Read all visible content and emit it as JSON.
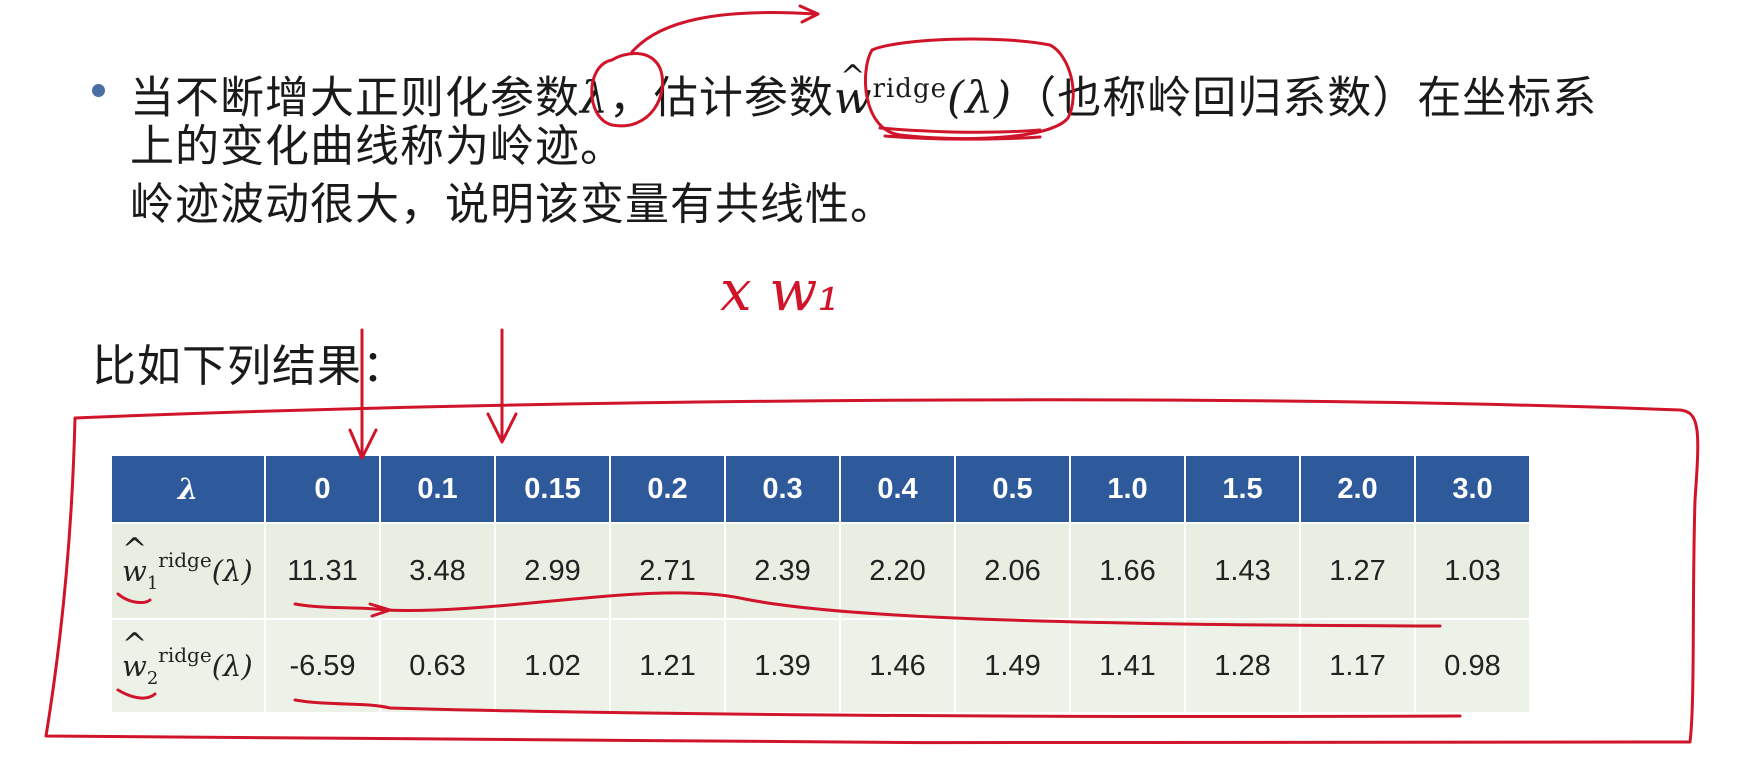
{
  "slide": {
    "line1_a": "当不断增大正则化参数",
    "lambda": "λ",
    "line1_b": "，估计参数",
    "w": "w",
    "ridge_sup": "ridge",
    "lambda_arg": "(λ)",
    "line1_c": "（也称岭回归系数）在坐标系",
    "line2": "上的变化曲线称为岭迹。",
    "line3": "岭迹波动很大，说明该变量有共线性。",
    "intro": "比如下列结果："
  },
  "handwriting": {
    "note": "x w₁"
  },
  "table": {
    "header_label": "λ",
    "lambdas": [
      "0",
      "0.1",
      "0.15",
      "0.2",
      "0.3",
      "0.4",
      "0.5",
      "1.0",
      "1.5",
      "2.0",
      "3.0"
    ],
    "rows": [
      {
        "w": "w",
        "sub": "1",
        "sup": "ridge",
        "arg": "(λ)",
        "values": [
          "11.31",
          "3.48",
          "2.99",
          "2.71",
          "2.39",
          "2.20",
          "2.06",
          "1.66",
          "1.43",
          "1.27",
          "1.03"
        ]
      },
      {
        "w": "w",
        "sub": "2",
        "sup": "ridge",
        "arg": "(λ)",
        "values": [
          "-6.59",
          "0.63",
          "1.02",
          "1.21",
          "1.39",
          "1.46",
          "1.49",
          "1.41",
          "1.28",
          "1.17",
          "0.98"
        ]
      }
    ]
  },
  "colors": {
    "header_bg": "#2e5a9c",
    "row_bg": "#e9eee3",
    "ink": "#d0142a",
    "bullet": "#4a6fa5"
  }
}
